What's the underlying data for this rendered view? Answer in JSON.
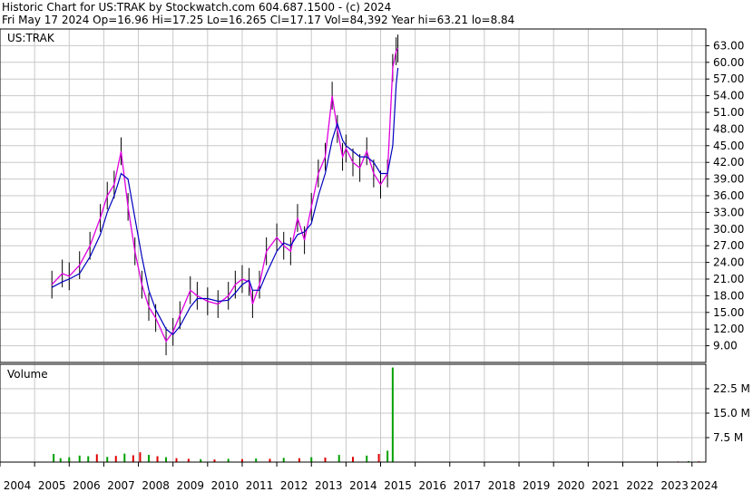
{
  "header": {
    "title_line": "Historic Chart for US:TRAK by Stockwatch.com 604.687.1500 - (c) 2024",
    "stats_line": "Fri May 17 2024   Op=16.96   Hi=17.25   Lo=16.265   Cl=17.17   Vol=84,392   Year hi=63.21   lo=8.84"
  },
  "price_panel": {
    "symbol_label": "US:TRAK"
  },
  "volume_panel": {
    "label": "Volume"
  },
  "colors": {
    "price_bar": "#000000",
    "ma_short": "#e000e0",
    "ma_long": "#0000c0",
    "vol_up": "#00a000",
    "vol_down": "#e00000",
    "grid": "#c8c8c8"
  },
  "chart_data": [
    {
      "type": "line",
      "title": "",
      "xlabel": "",
      "ylabel": "",
      "ylim": [
        6,
        66
      ],
      "xlim": [
        2004.0,
        2024.4
      ],
      "grid": true,
      "y_ticks": [
        "9.00",
        "12.00",
        "15.00",
        "18.00",
        "21.00",
        "24.00",
        "27.00",
        "30.00",
        "33.00",
        "36.00",
        "39.00",
        "42.00",
        "45.00",
        "48.00",
        "51.00",
        "54.00",
        "57.00",
        "60.00",
        "63.00"
      ],
      "x_ticks": [
        "2004",
        "2005",
        "2006",
        "2007",
        "2008",
        "2009",
        "2010",
        "2011",
        "2012",
        "2013",
        "2014",
        "2015",
        "2016",
        "2017",
        "2018",
        "2019",
        "2020",
        "2021",
        "2022",
        "2023",
        "2024"
      ],
      "series": [
        {
          "name": "",
          "x": [
            2005.5,
            2005.8,
            2006.0,
            2006.3,
            2006.6,
            2006.9,
            2007.1,
            2007.3,
            2007.5,
            2007.7,
            2007.9,
            2008.1,
            2008.3,
            2008.5,
            2008.8,
            2009.0,
            2009.2,
            2009.5,
            2009.7,
            2010.0,
            2010.3,
            2010.6,
            2010.8,
            2011.0,
            2011.2,
            2011.3,
            2011.5,
            2011.7,
            2012.0,
            2012.2,
            2012.4,
            2012.6,
            2012.8,
            2013.0,
            2013.2,
            2013.4,
            2013.6,
            2013.75,
            2013.9,
            2014.0,
            2014.2,
            2014.4,
            2014.6,
            2014.8,
            2015.0,
            2015.2,
            2015.35,
            2015.45,
            2015.5
          ],
          "y": [
            20.0,
            22.0,
            21.5,
            23.5,
            27.0,
            32.0,
            36.0,
            38.0,
            44.0,
            34.0,
            26.0,
            20.0,
            16.0,
            14.0,
            9.8,
            11.5,
            14.5,
            19.0,
            18.0,
            17.0,
            16.5,
            18.0,
            20.0,
            21.0,
            20.5,
            16.5,
            20.0,
            26.0,
            28.5,
            27.0,
            26.0,
            32.0,
            28.0,
            34.0,
            40.0,
            43.0,
            54.0,
            48.0,
            43.0,
            44.5,
            42.0,
            41.0,
            44.0,
            40.0,
            38.0,
            40.0,
            59.0,
            62.0,
            62.5
          ]
        },
        {
          "name": "",
          "x": [
            2005.5,
            2005.8,
            2006.0,
            2006.3,
            2006.6,
            2006.9,
            2007.1,
            2007.3,
            2007.5,
            2007.7,
            2007.9,
            2008.1,
            2008.3,
            2008.5,
            2008.8,
            2009.0,
            2009.2,
            2009.5,
            2009.7,
            2010.0,
            2010.3,
            2010.6,
            2010.8,
            2011.0,
            2011.2,
            2011.3,
            2011.5,
            2011.7,
            2012.0,
            2012.2,
            2012.4,
            2012.6,
            2012.8,
            2013.0,
            2013.2,
            2013.4,
            2013.6,
            2013.75,
            2013.9,
            2014.0,
            2014.2,
            2014.4,
            2014.6,
            2014.8,
            2015.0,
            2015.2,
            2015.35,
            2015.45,
            2015.5
          ],
          "y": [
            19.5,
            20.5,
            21.0,
            22.0,
            25.0,
            29.0,
            33.0,
            36.0,
            40.0,
            39.0,
            32.0,
            25.0,
            19.0,
            15.5,
            12.0,
            11.0,
            12.5,
            16.0,
            17.5,
            17.5,
            17.0,
            17.2,
            18.5,
            20.0,
            20.8,
            19.0,
            19.0,
            22.0,
            26.0,
            27.5,
            27.0,
            29.0,
            29.5,
            31.0,
            36.0,
            40.0,
            46.0,
            49.0,
            46.0,
            45.0,
            44.0,
            43.0,
            43.0,
            42.0,
            40.0,
            40.0,
            45.0,
            56.0,
            59.0
          ]
        }
      ]
    },
    {
      "type": "bar",
      "title": "",
      "xlabel": "",
      "ylabel": "",
      "ylim": [
        0,
        30000000
      ],
      "y_ticks": [
        "7.5 M",
        "15.0 M",
        "22.5 M"
      ],
      "x": [
        2005.55,
        2005.75,
        2006.0,
        2006.3,
        2006.55,
        2006.8,
        2007.1,
        2007.35,
        2007.6,
        2007.85,
        2008.05,
        2008.3,
        2008.55,
        2008.8,
        2009.1,
        2009.45,
        2009.8,
        2010.2,
        2010.6,
        2011.0,
        2011.4,
        2011.8,
        2012.2,
        2012.65,
        2013.0,
        2013.4,
        2013.8,
        2014.2,
        2014.6,
        2014.95,
        2015.2,
        2015.35,
        2023.6,
        2023.9,
        2024.2
      ],
      "values": [
        2500000,
        1200000,
        1500000,
        2000000,
        1800000,
        2400000,
        1600000,
        1900000,
        2600000,
        2100000,
        3000000,
        2200000,
        1800000,
        1500000,
        1200000,
        1000000,
        900000,
        800000,
        1000000,
        900000,
        1100000,
        1000000,
        1300000,
        1200000,
        1500000,
        1400000,
        2200000,
        1600000,
        2000000,
        2500000,
        3500000,
        29000000,
        200000,
        300000,
        250000
      ],
      "direction": [
        "up",
        "up",
        "up",
        "up",
        "up",
        "down",
        "up",
        "down",
        "up",
        "down",
        "down",
        "up",
        "down",
        "up",
        "down",
        "down",
        "up",
        "down",
        "up",
        "down",
        "up",
        "down",
        "up",
        "down",
        "up",
        "down",
        "up",
        "down",
        "up",
        "down",
        "up",
        "up",
        "down",
        "up",
        "down"
      ]
    }
  ]
}
